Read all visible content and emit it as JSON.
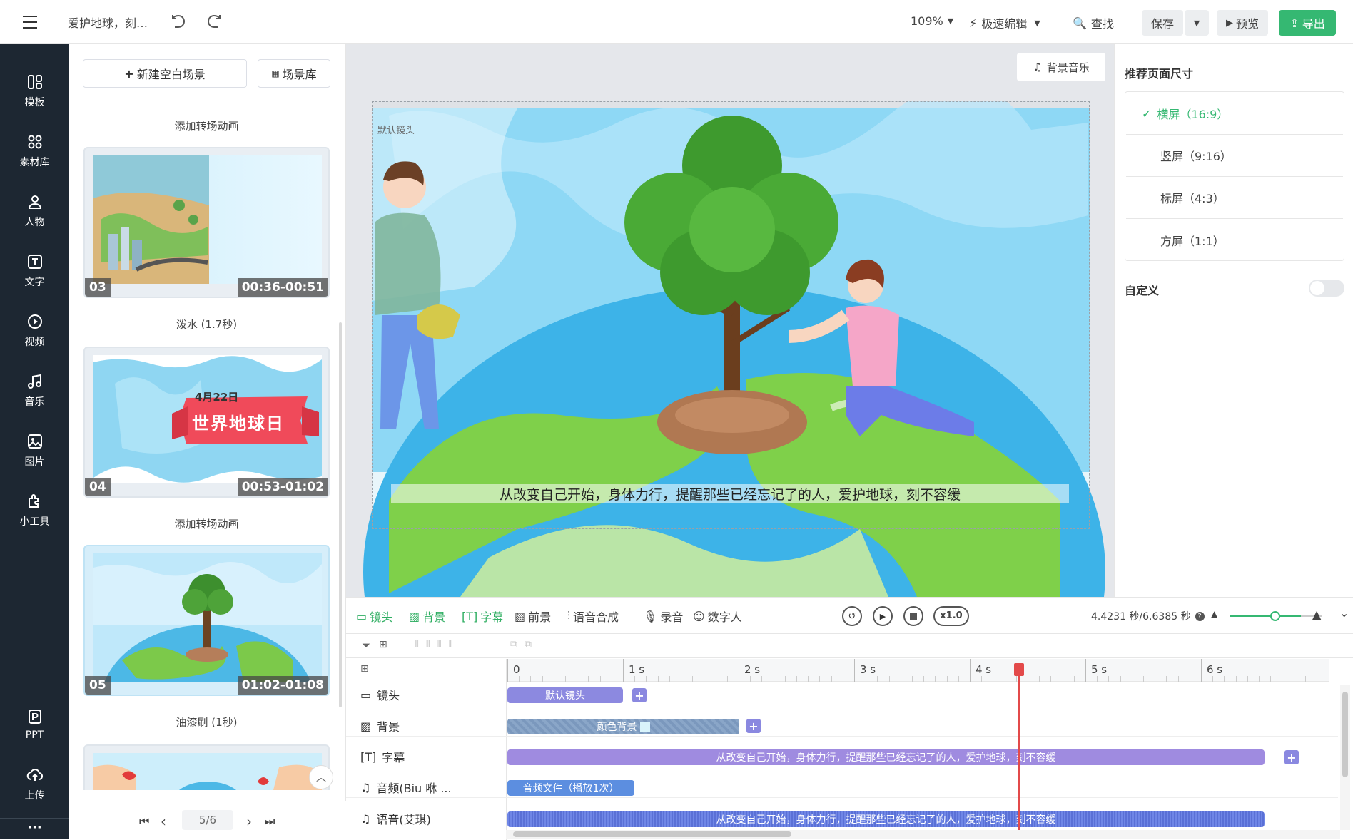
{
  "topbar": {
    "title": "爱护地球，刻…",
    "zoom": "109%",
    "mode": "极速编辑",
    "find": "查找",
    "save": "保存",
    "preview": "预览",
    "export": "导出"
  },
  "rail": {
    "items": [
      "模板",
      "素材库",
      "人物",
      "文字",
      "视频",
      "音乐",
      "图片",
      "小工具"
    ],
    "bottom": [
      "PPT",
      "上传"
    ],
    "more": "···"
  },
  "scenes": {
    "new_blank": "新建空白场景",
    "library": "场景库",
    "transitions": [
      "添加转场动画",
      "泼水 (1.7秒)",
      "添加转场动画",
      "油漆刷 (1秒)"
    ],
    "cards": [
      {
        "num": "03",
        "time": "00:36-00:51"
      },
      {
        "num": "04",
        "time": "00:53-01:02",
        "subtitle": "4月22日",
        "title": "世界地球日"
      },
      {
        "num": "05",
        "time": "01:02-01:08"
      }
    ],
    "pager": "5/6"
  },
  "stage": {
    "bg_music": "背景音乐",
    "camera_label": "默认镜头",
    "caption": "从改变自己开始，身体力行，提醒那些已经忘记了的人，爱护地球，刻不容缓"
  },
  "right": {
    "heading": "推荐页面尺寸",
    "sizes": [
      "横屏（16:9）",
      "竖屏（9:16）",
      "标屏（4:3）",
      "方屏（1:1）"
    ],
    "selected": 0,
    "custom": "自定义"
  },
  "timeline": {
    "tabs": [
      "镜头",
      "背景",
      "字幕",
      "前景",
      "语音合成",
      "录音",
      "数字人"
    ],
    "speed": "x1.0",
    "time": "4.4231 秒/6.6385 秒",
    "ticks": [
      "0",
      "1 s",
      "2 s",
      "3 s",
      "4 s",
      "5 s",
      "6 s"
    ],
    "playhead_seconds": 4.4231,
    "duration_seconds": 6.6385,
    "tracks": [
      {
        "label": "镜头",
        "clip": "默认镜头"
      },
      {
        "label": "背景",
        "clip": "颜色背景"
      },
      {
        "label": "字幕",
        "clip": "从改变自己开始，身体力行，提醒那些已经忘记了的人，爱护地球，刻不容缓"
      },
      {
        "label": "音频(Biu 咻 ...",
        "clip": "音频文件（播放1次）"
      },
      {
        "label": "语音(艾琪)",
        "clip": "从改变自己开始，身体力行，提醒那些已经忘记了的人，爱护地球，刻不容缓"
      }
    ]
  }
}
